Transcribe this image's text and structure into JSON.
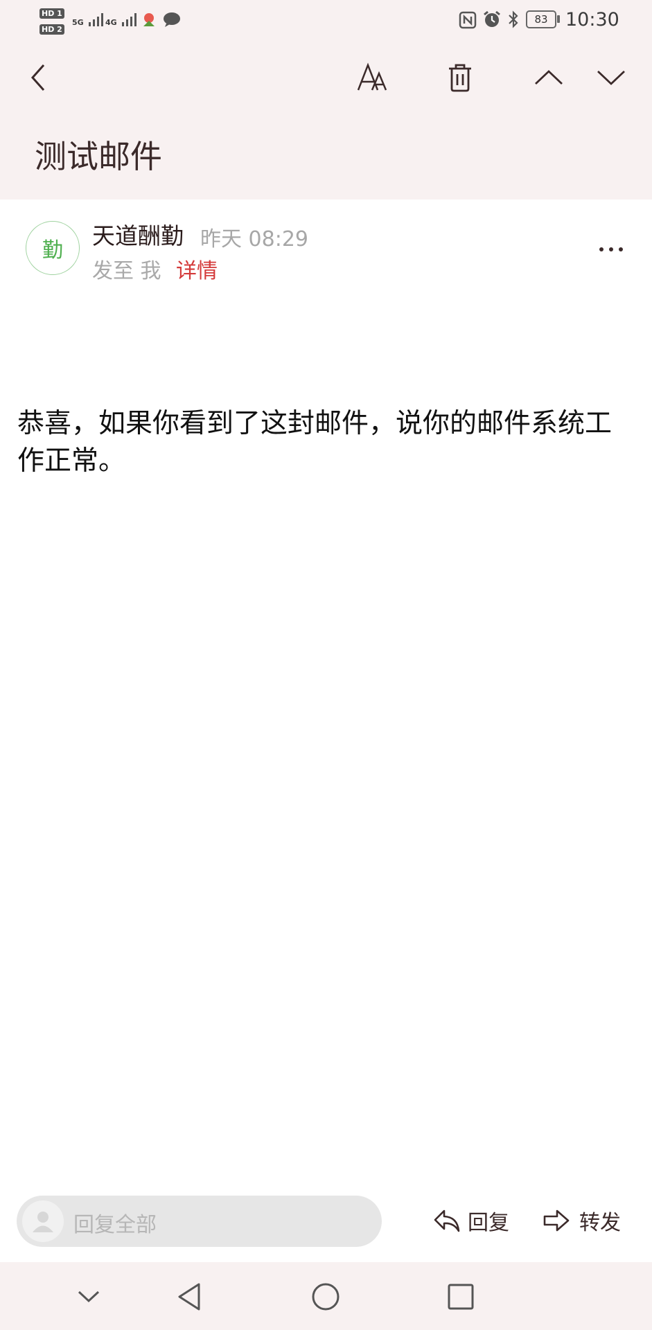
{
  "status_bar": {
    "hd1": "HD 1",
    "hd2": "HD 2",
    "net1": "5G",
    "net2": "4G",
    "battery": "83",
    "time": "10:30",
    "icons": [
      "signal-icon",
      "wechat-icon",
      "nfc-icon",
      "alarm-icon",
      "bluetooth-icon",
      "battery-icon"
    ]
  },
  "toolbar": {
    "icons": [
      "back-arrow-icon",
      "font-size-icon",
      "trash-icon",
      "chevron-up-icon",
      "chevron-down-icon"
    ]
  },
  "email": {
    "subject": "测试邮件",
    "sender_initial": "勤",
    "sender_name": "天道酬勤",
    "time": "昨天 08:29",
    "to_line": "发至 我",
    "details_label": "详情",
    "body": "恭喜，如果你看到了这封邮件，说你的邮件系统工作正常。"
  },
  "actions": {
    "reply_all_placeholder": "回复全部",
    "reply_label": "回复",
    "forward_label": "转发"
  },
  "colors": {
    "header_bg": "#f8f1f1",
    "accent_red": "#d43a3a",
    "avatar_green": "#4faf4f"
  }
}
